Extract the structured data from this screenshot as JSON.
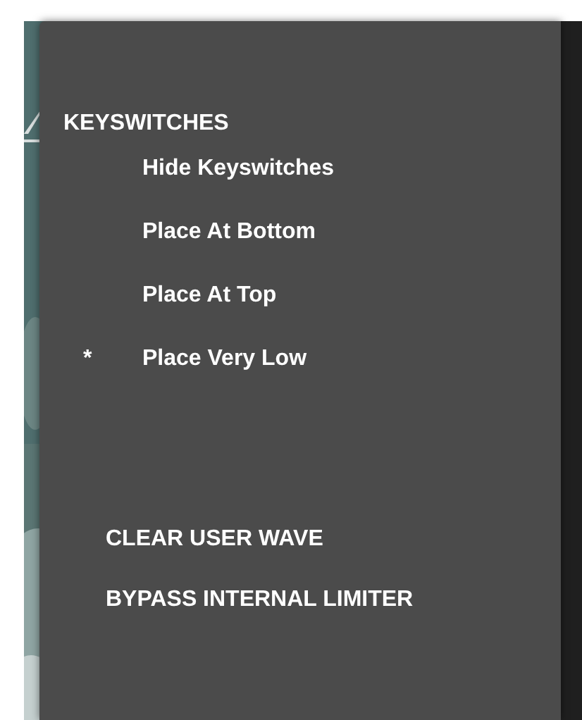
{
  "menu": {
    "heading": "KEYSWITCHES",
    "selected_marker": "*",
    "options": [
      {
        "label": "Hide Keyswitches",
        "selected": false
      },
      {
        "label": "Place At Bottom",
        "selected": false
      },
      {
        "label": "Place At Top",
        "selected": false
      },
      {
        "label": "Place Very Low",
        "selected": true
      }
    ],
    "actions": [
      "CLEAR USER WAVE",
      "BYPASS INTERNAL LIMITER"
    ]
  }
}
